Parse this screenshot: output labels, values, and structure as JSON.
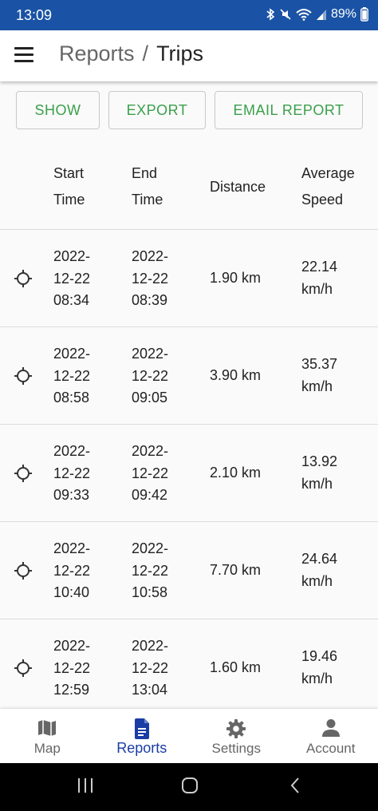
{
  "status": {
    "time": "13:09",
    "battery": "89%"
  },
  "header": {
    "breadcrumb_parent": "Reports",
    "breadcrumb_separator": "/",
    "title": "Trips"
  },
  "actions": {
    "show": "SHOW",
    "export": "EXPORT",
    "email": "EMAIL REPORT"
  },
  "table": {
    "columns": {
      "start": [
        "Start",
        "Time"
      ],
      "end": [
        "End",
        "Time"
      ],
      "distance": "Distance",
      "speed": [
        "Average",
        "Speed"
      ]
    },
    "rows": [
      {
        "start": [
          "2022-",
          "12-22",
          "08:34"
        ],
        "end": [
          "2022-",
          "12-22",
          "08:39"
        ],
        "distance": "1.90 km",
        "speed": [
          "22.14",
          "km/h"
        ]
      },
      {
        "start": [
          "2022-",
          "12-22",
          "08:58"
        ],
        "end": [
          "2022-",
          "12-22",
          "09:05"
        ],
        "distance": "3.90 km",
        "speed": [
          "35.37",
          "km/h"
        ]
      },
      {
        "start": [
          "2022-",
          "12-22",
          "09:33"
        ],
        "end": [
          "2022-",
          "12-22",
          "09:42"
        ],
        "distance": "2.10 km",
        "speed": [
          "13.92",
          "km/h"
        ]
      },
      {
        "start": [
          "2022-",
          "12-22",
          "10:40"
        ],
        "end": [
          "2022-",
          "12-22",
          "10:58"
        ],
        "distance": "7.70 km",
        "speed": [
          "24.64",
          "km/h"
        ]
      },
      {
        "start": [
          "2022-",
          "12-22",
          "12:59"
        ],
        "end": [
          "2022-",
          "12-22",
          "13:04"
        ],
        "distance": "1.60 km",
        "speed": [
          "19.46",
          "km/h"
        ]
      }
    ]
  },
  "nav": {
    "items": [
      {
        "label": "Map",
        "icon": "map-icon",
        "active": false
      },
      {
        "label": "Reports",
        "icon": "document-icon",
        "active": true
      },
      {
        "label": "Settings",
        "icon": "gear-icon",
        "active": false
      },
      {
        "label": "Account",
        "icon": "person-icon",
        "active": false
      }
    ]
  },
  "colors": {
    "primary": "#1a53a5",
    "accent_green": "#3aa04a",
    "active_nav": "#1a3da5"
  }
}
